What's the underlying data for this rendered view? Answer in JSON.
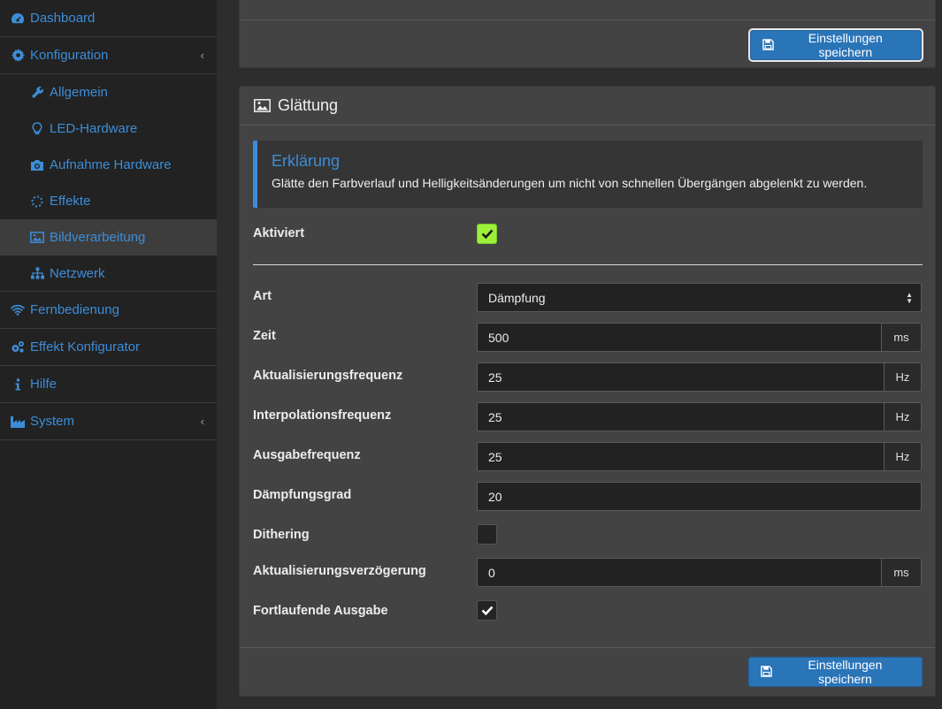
{
  "sidebar": {
    "items": [
      {
        "label": "Dashboard",
        "icon": "dashboard-icon"
      },
      {
        "label": "Konfiguration",
        "icon": "gear-icon",
        "caret": "‹"
      },
      {
        "label": "Allgemein",
        "icon": "wrench-icon"
      },
      {
        "label": "LED-Hardware",
        "icon": "lightbulb-icon"
      },
      {
        "label": "Aufnahme Hardware",
        "icon": "camera-icon"
      },
      {
        "label": "Effekte",
        "icon": "spinner-icon"
      },
      {
        "label": "Bildverarbeitung",
        "icon": "image-icon",
        "active": true
      },
      {
        "label": "Netzwerk",
        "icon": "sitemap-icon"
      },
      {
        "label": "Fernbedienung",
        "icon": "wifi-icon"
      },
      {
        "label": "Effekt Konfigurator",
        "icon": "cogs-icon"
      },
      {
        "label": "Hilfe",
        "icon": "info-icon"
      },
      {
        "label": "System",
        "icon": "industry-icon",
        "caret": "‹"
      }
    ]
  },
  "top_card": {
    "save_label": "Einstellungen speichern"
  },
  "smoothing": {
    "title": "Glättung",
    "callout_title": "Erklärung",
    "callout_text": "Glätte den Farbverlauf und Helligkeitsänderungen um nicht von schnellen Übergängen abgelenkt zu werden.",
    "activated_label": "Aktiviert",
    "activated": true,
    "type_label": "Art",
    "type_value": "Dämpfung",
    "time_label": "Zeit",
    "time_value": "500",
    "time_unit": "ms",
    "update_freq_label": "Aktualisierungsfrequenz",
    "update_freq_value": "25",
    "update_freq_unit": "Hz",
    "interp_freq_label": "Interpolationsfrequenz",
    "interp_freq_value": "25",
    "interp_freq_unit": "Hz",
    "output_freq_label": "Ausgabefrequenz",
    "output_freq_value": "25",
    "output_freq_unit": "Hz",
    "damping_label": "Dämpfungsgrad",
    "damping_value": "20",
    "dithering_label": "Dithering",
    "dithering": false,
    "update_delay_label": "Aktualisierungsverzögerung",
    "update_delay_value": "0",
    "update_delay_unit": "ms",
    "continuous_label": "Fortlaufende Ausgabe",
    "continuous": true,
    "save_label": "Einstellungen speichern"
  },
  "colors": {
    "accent": "#3c8dd8",
    "checkbox_active": "#9cf03a",
    "button": "#2a74b8"
  }
}
